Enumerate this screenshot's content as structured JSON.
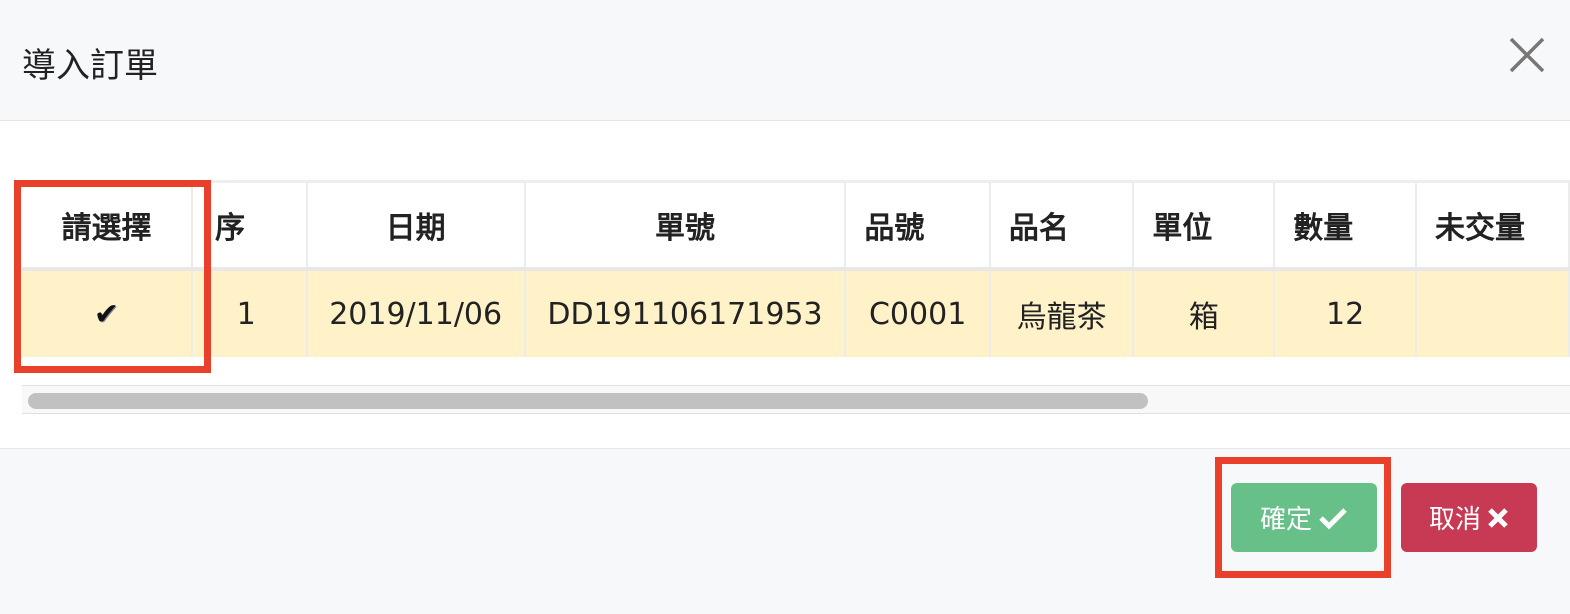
{
  "dialog": {
    "title": "導入訂單"
  },
  "table": {
    "headers": [
      "請選擇",
      "序",
      "日期",
      "單號",
      "品號",
      "品名",
      "單位",
      "數量",
      "未交量"
    ],
    "rows": [
      {
        "selected": true,
        "seq": "1",
        "date": "2019/11/06",
        "order_no": "DD191106171953",
        "item_no": "C0001",
        "item_name": "烏龍茶",
        "unit": "箱",
        "qty": "12",
        "pending": ""
      }
    ]
  },
  "footer": {
    "confirm_label": "確定",
    "cancel_label": "取消"
  },
  "colors": {
    "confirm": "#66c087",
    "cancel": "#c83953",
    "highlight": "#e8402a",
    "row": "#fff2c9"
  }
}
